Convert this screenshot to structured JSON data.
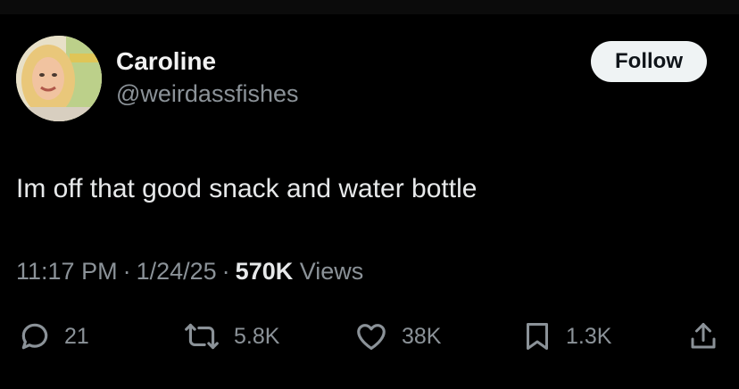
{
  "user": {
    "display_name": "Caroline",
    "handle": "@weirdassfishes",
    "avatar": "profile-photo-avatar"
  },
  "follow_label": "Follow",
  "tweet": {
    "text": "Im off that good snack and water bottle",
    "time": "11:17 PM",
    "date": "1/24/25",
    "views_count": "570K",
    "views_label": "Views"
  },
  "actions": {
    "replies": "21",
    "reposts": "5.8K",
    "likes": "38K",
    "bookmarks": "1.3K"
  },
  "icons": {
    "reply": "speech-bubble-icon",
    "repost": "repost-arrows-icon",
    "like": "heart-outline-icon",
    "bookmark": "bookmark-icon",
    "share": "share-upload-icon"
  },
  "colors": {
    "background": "#000000",
    "primary_text": "#e7e9ea",
    "secondary_text": "#8b9298",
    "follow_button_bg": "#eff3f4"
  }
}
